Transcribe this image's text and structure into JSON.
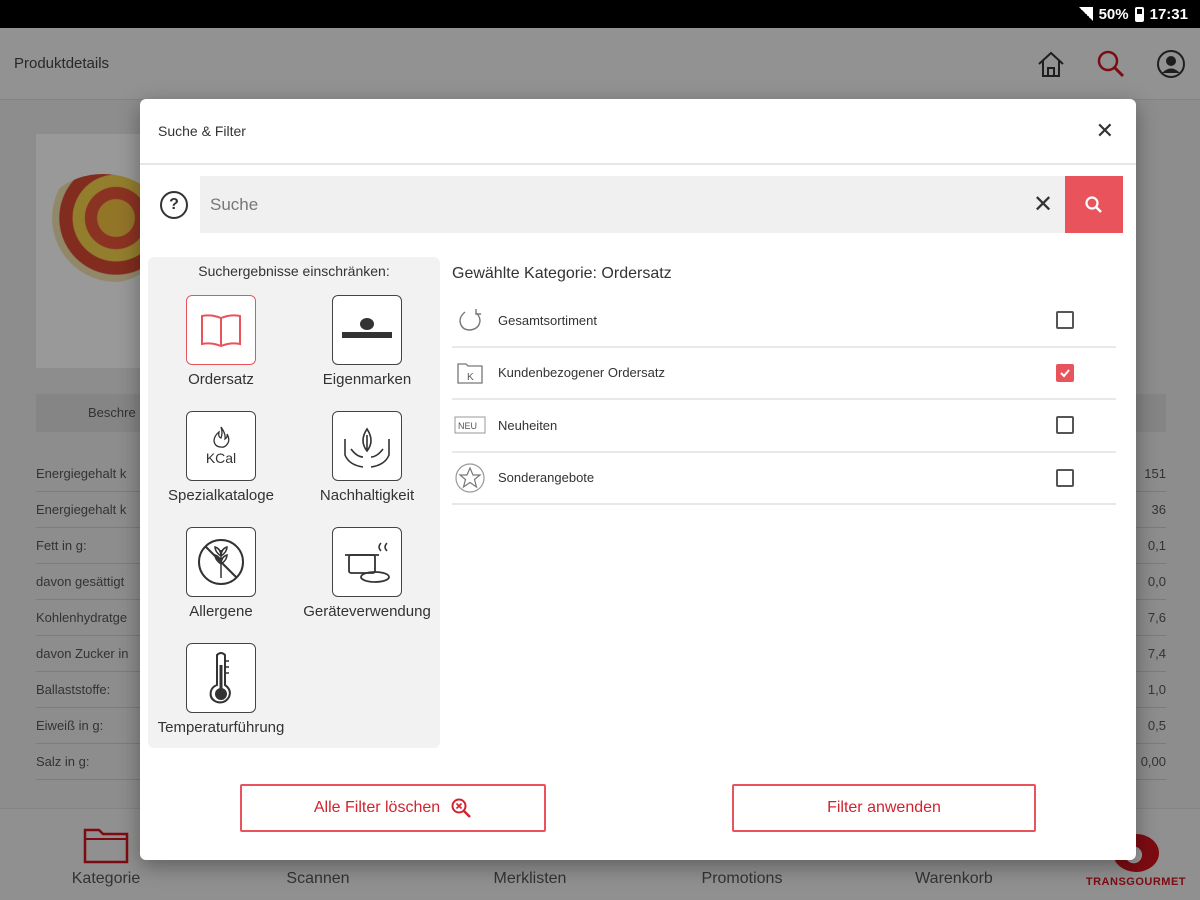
{
  "statusbar": {
    "battery": "50%",
    "time": "17:31"
  },
  "app": {
    "title": "Produktdetails",
    "tab_partial": "Beschre",
    "nutrition": [
      {
        "label": "Energiegehalt k",
        "value": "151"
      },
      {
        "label": "Energiegehalt k",
        "value": "36"
      },
      {
        "label": "Fett in g:",
        "value": "0,1"
      },
      {
        "label": "davon gesättigt",
        "value": "0,0"
      },
      {
        "label": "Kohlenhydratge",
        "value": "7,6"
      },
      {
        "label": "davon Zucker in",
        "value": "7,4"
      },
      {
        "label": "Ballaststoffe:",
        "value": "1,0"
      },
      {
        "label": "Eiweiß in g:",
        "value": "0,5"
      },
      {
        "label": "Salz in g:",
        "value": "0,00"
      }
    ],
    "bottom_nav": [
      "Kategorie",
      "Scannen",
      "Merklisten",
      "Promotions",
      "Warenkorb"
    ],
    "brand": "TRANSGOURMET"
  },
  "dialog": {
    "title": "Suche & Filter",
    "search_placeholder": "Suche",
    "restrict_title": "Suchergebnisse einschränken:",
    "categories": [
      {
        "label": "Ordersatz",
        "icon": "book-icon",
        "active": true
      },
      {
        "label": "Eigenmarken",
        "icon": "transgourmet-logo-icon",
        "active": false
      },
      {
        "label": "Spezialkataloge",
        "icon": "kcal-flame-icon",
        "active": false
      },
      {
        "label": "Nachhaltigkeit",
        "icon": "hands-leaf-icon",
        "active": false
      },
      {
        "label": "Allergene",
        "icon": "no-wheat-icon",
        "active": false
      },
      {
        "label": "Geräteverwendung",
        "icon": "cooking-pot-icon",
        "active": false
      },
      {
        "label": "Temperaturführung",
        "icon": "thermometer-icon",
        "active": false
      }
    ],
    "selected_category": "Gewählte Kategorie: Ordersatz",
    "options": [
      {
        "label": "Gesamtsortiment",
        "icon": "refresh-icon",
        "checked": false
      },
      {
        "label": "Kundenbezogener Ordersatz",
        "icon": "k-folder-icon",
        "checked": true,
        "icon_text": "K"
      },
      {
        "label": "Neuheiten",
        "icon": "new-badge-icon",
        "checked": false,
        "icon_text": "NEU"
      },
      {
        "label": "Sonderangebote",
        "icon": "star-icon",
        "checked": false
      }
    ],
    "clear_label": "Alle Filter löschen",
    "apply_label": "Filter anwenden"
  },
  "colors": {
    "accent": "#e9545c",
    "brand": "#d0141e"
  }
}
